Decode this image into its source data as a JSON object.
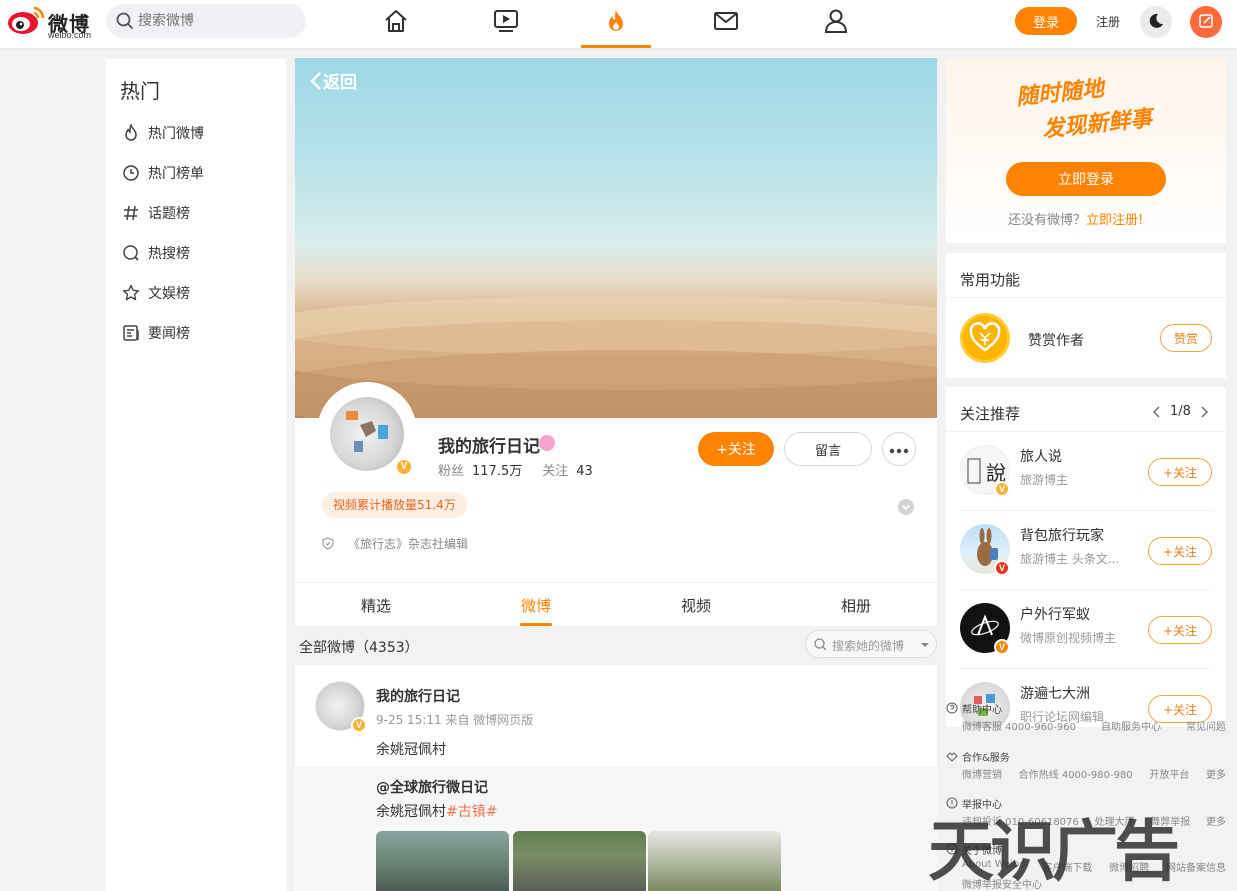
{
  "header": {
    "logo_text": "微博",
    "logo_sub": "weibo.com",
    "search_placeholder": "搜索微博",
    "login_label": "登录",
    "register_label": "注册"
  },
  "sidebar": {
    "title": "热门",
    "items": [
      {
        "label": "热门微博",
        "icon": "flame-icon"
      },
      {
        "label": "热门榜单",
        "icon": "clock-icon"
      },
      {
        "label": "话题榜",
        "icon": "hash-icon"
      },
      {
        "label": "热搜榜",
        "icon": "search-circle-icon"
      },
      {
        "label": "文娱榜",
        "icon": "star-icon"
      },
      {
        "label": "要闻榜",
        "icon": "news-icon"
      }
    ]
  },
  "profile": {
    "back_label": "返回",
    "name": "我的旅行日记",
    "fans_label": "粉丝",
    "fans_value": "117.5万",
    "follow_label": "关注",
    "follow_value": "43",
    "follow_button": "+关注",
    "message_button": "留言",
    "plays_badge": "视频累计播放量51.4万",
    "description": "《旅行志》杂志社编辑"
  },
  "tabs": [
    "精选",
    "微博",
    "视频",
    "相册"
  ],
  "feed": {
    "all_label": "全部微博（4353）",
    "search_placeholder": "搜索她的微博"
  },
  "post": {
    "author": "我的旅行日记",
    "meta": "9-25 15:11  来自 微博网页版",
    "text": "余姚冠佩村",
    "repost_author": "@全球旅行微日记",
    "repost_text": "余姚冠佩村",
    "repost_hashtag": "#古镇#"
  },
  "login_card": {
    "slogan_line1": "随时随地",
    "slogan_line2": "发现新鲜事",
    "login_button": "立即登录",
    "no_account": "还没有微博？",
    "register_link": "立即注册!"
  },
  "functions": {
    "title": "常用功能",
    "reward_label": "赞赏作者",
    "reward_button": "赞赏"
  },
  "recommend": {
    "title": "关注推荐",
    "page": "1/8",
    "follow_label": "+关注",
    "items": [
      {
        "name": "旅人说",
        "desc": "旅游博主"
      },
      {
        "name": "背包旅行玩家",
        "desc": "旅游博主 头条文..."
      },
      {
        "name": "户外行军蚁",
        "desc": "微博原创视频博主"
      },
      {
        "name": "游遍七大洲",
        "desc": "职行论坛网编辑"
      }
    ]
  },
  "footer": {
    "help_title": "帮助中心",
    "help_links": [
      "微博客服 4000-960-960",
      "自助服务中心",
      "常见问题"
    ],
    "coop_title": "合作&服务",
    "coop_links": [
      "微博营销",
      "合作热线 4000-980-980",
      "开放平台",
      "更多"
    ],
    "report_title": "举报中心",
    "report_links": [
      "违规投诉 010-60618076",
      "处理大厅",
      "舞弊举报",
      "更多"
    ],
    "about_title": "关于微博",
    "about_links": [
      "About Weibo",
      "客户端下载",
      "微博招聘",
      "网站备案信息"
    ],
    "about_links2": "微博举报安全中心"
  },
  "watermark": "天识广告",
  "colors": {
    "accent": "#ff8200",
    "hashtag": "#eb7350"
  }
}
